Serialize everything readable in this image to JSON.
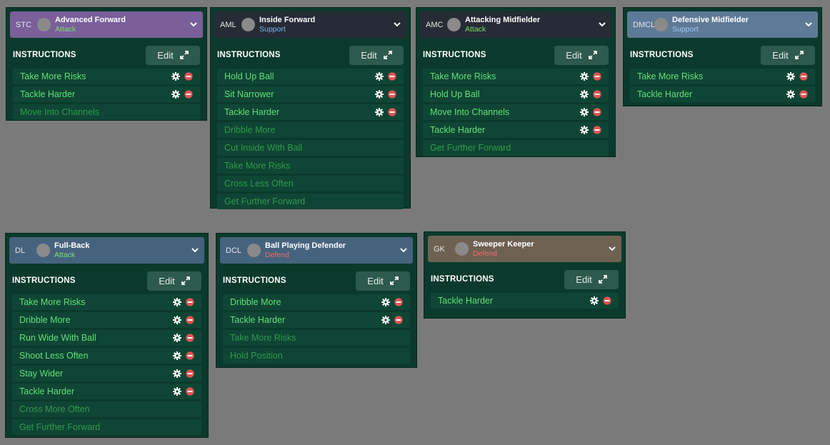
{
  "cards": [
    {
      "id": "stc",
      "position": "STC",
      "role": "Advanced Forward",
      "duty": "Attack",
      "duty_color": "#78e06a",
      "header_color": "#7a5f9a",
      "edit_label": "Edit",
      "instructions_title": "INSTRUCTIONS",
      "instructions": [
        {
          "label": "Take More Risks",
          "active": true
        },
        {
          "label": "Tackle Harder",
          "active": true
        },
        {
          "label": "Move Into Channels",
          "active": false
        }
      ]
    },
    {
      "id": "aml",
      "position": "AML",
      "role": "Inside Forward",
      "duty": "Support",
      "duty_color": "#7ab8f0",
      "header_color": "#262b35",
      "edit_label": "Edit",
      "instructions_title": "INSTRUCTIONS",
      "instructions": [
        {
          "label": "Hold Up Ball",
          "active": true
        },
        {
          "label": "Sit Narrower",
          "active": true
        },
        {
          "label": "Tackle Harder",
          "active": true
        },
        {
          "label": "Dribble More",
          "active": false
        },
        {
          "label": "Cut Inside With Ball",
          "active": false
        },
        {
          "label": "Take More Risks",
          "active": false
        },
        {
          "label": "Cross Less Often",
          "active": false
        },
        {
          "label": "Get Further Forward",
          "active": false
        }
      ]
    },
    {
      "id": "amc",
      "position": "AMC",
      "role": "Attacking Midfielder",
      "duty": "Attack",
      "duty_color": "#78e06a",
      "header_color": "#262b35",
      "edit_label": "Edit",
      "instructions_title": "INSTRUCTIONS",
      "instructions": [
        {
          "label": "Take More Risks",
          "active": true
        },
        {
          "label": "Hold Up Ball",
          "active": true
        },
        {
          "label": "Move Into Channels",
          "active": true
        },
        {
          "label": "Tackle Harder",
          "active": true
        },
        {
          "label": "Get Further Forward",
          "active": false
        }
      ]
    },
    {
      "id": "dmcl",
      "position": "DMCL",
      "role": "Defensive Midfielder",
      "duty": "Support",
      "duty_color": "#9cc8f0",
      "header_color": "#5e7a96",
      "edit_label": "Edit",
      "instructions_title": "INSTRUCTIONS",
      "instructions": [
        {
          "label": "Take More Risks",
          "active": true
        },
        {
          "label": "Tackle Harder",
          "active": true
        }
      ]
    },
    {
      "id": "dl",
      "position": "DL",
      "role": "Full-Back",
      "duty": "Attack",
      "duty_color": "#78e06a",
      "header_color": "#46637e",
      "edit_label": "Edit",
      "instructions_title": "INSTRUCTIONS",
      "instructions": [
        {
          "label": "Take More Risks",
          "active": true
        },
        {
          "label": "Dribble More",
          "active": true
        },
        {
          "label": "Run Wide With Ball",
          "active": true
        },
        {
          "label": "Shoot Less Often",
          "active": true
        },
        {
          "label": "Stay Wider",
          "active": true
        },
        {
          "label": "Tackle Harder",
          "active": true
        },
        {
          "label": "Cross More Often",
          "active": false
        },
        {
          "label": "Get Further Forward",
          "active": false
        }
      ]
    },
    {
      "id": "dcl",
      "position": "DCL",
      "role": "Ball Playing Defender",
      "duty": "Defend",
      "duty_color": "#f06a6a",
      "header_color": "#46637e",
      "edit_label": "Edit",
      "instructions_title": "INSTRUCTIONS",
      "instructions": [
        {
          "label": "Dribble More",
          "active": true
        },
        {
          "label": "Tackle Harder",
          "active": true
        },
        {
          "label": "Take More Risks",
          "active": false
        },
        {
          "label": "Hold Position",
          "active": false
        }
      ]
    },
    {
      "id": "gk",
      "position": "GK",
      "role": "Sweeper Keeper",
      "duty": "Defend",
      "duty_color": "#f06a6a",
      "header_color": "#6e6152",
      "edit_label": "Edit",
      "instructions_title": "INSTRUCTIONS",
      "instructions": [
        {
          "label": "Tackle Harder",
          "active": true
        }
      ]
    }
  ]
}
